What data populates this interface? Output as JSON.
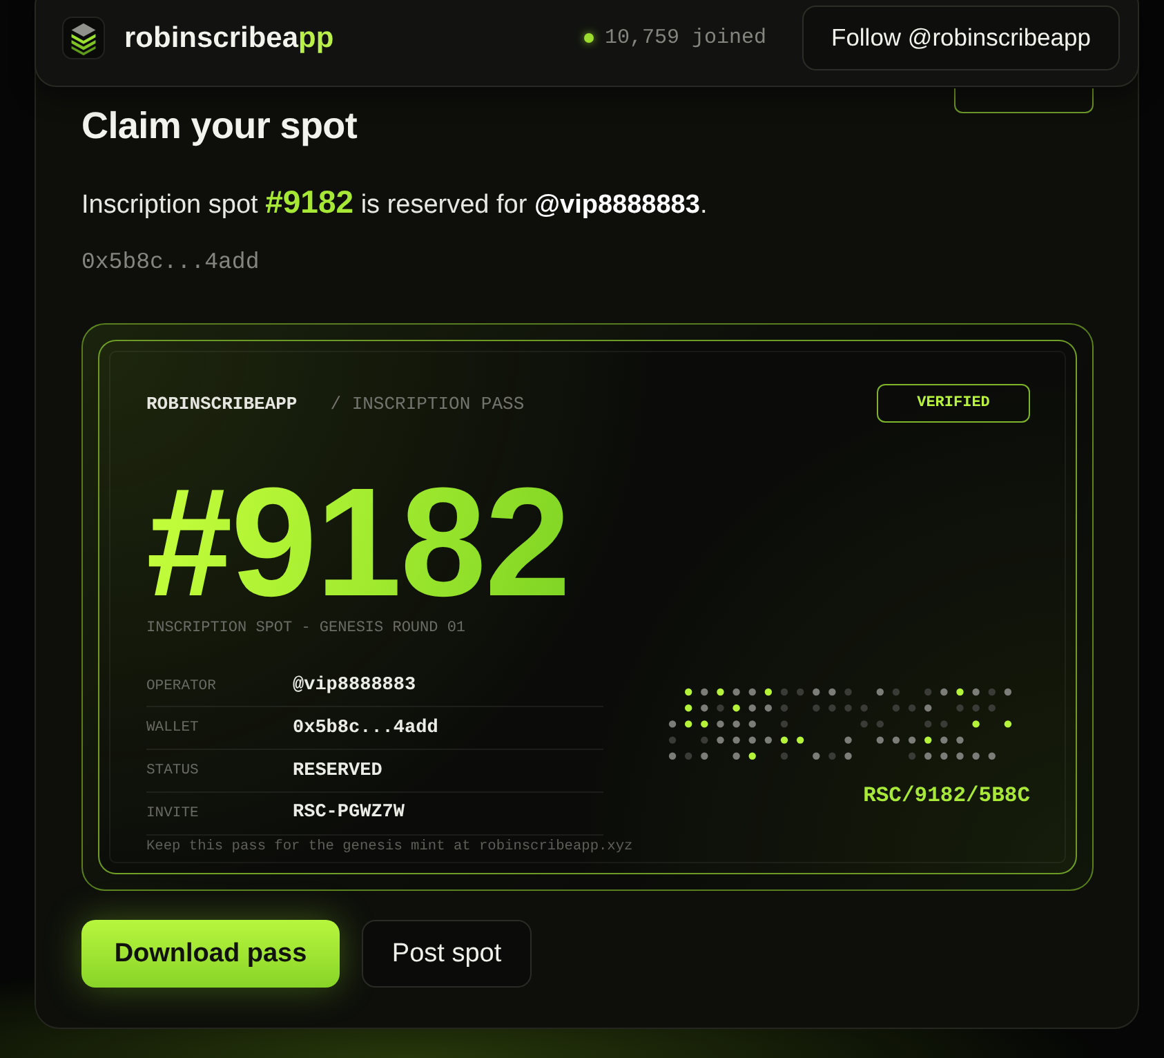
{
  "header": {
    "brand": "robinscribeapp",
    "joined": "10,759 joined",
    "follow_button": "Follow @robinscribeapp"
  },
  "claim": {
    "title": "Claim your spot",
    "message": "Inscription spot **#9182** is reserved for **@vip8888883**.",
    "wallet": "0x5b8c...4add"
  },
  "pass": {
    "brand": "ROBINSCRIBEAPP",
    "subtitle": "/ INSCRIPTION PASS",
    "badge": "VERIFIED",
    "number": "#9182",
    "caption": "INSCRIPTION SPOT - GENESIS ROUND 01",
    "fields": [
      {
        "label": "OPERATOR",
        "value": "@vip8888883"
      },
      {
        "label": "WALLET",
        "value": "0x5b8c...4add"
      },
      {
        "label": "STATUS",
        "value": "RESERVED"
      },
      {
        "label": "INVITE",
        "value": "RSC-PGWZ7W"
      }
    ],
    "note": "Keep this pass for the genesis mint at robinscribeapp.xyz",
    "code": "RSC/9182/5B8C"
  },
  "actions": [
    {
      "label": "Download pass",
      "kind": "primary"
    },
    {
      "label": "Post spot",
      "kind": "secondary"
    }
  ]
}
